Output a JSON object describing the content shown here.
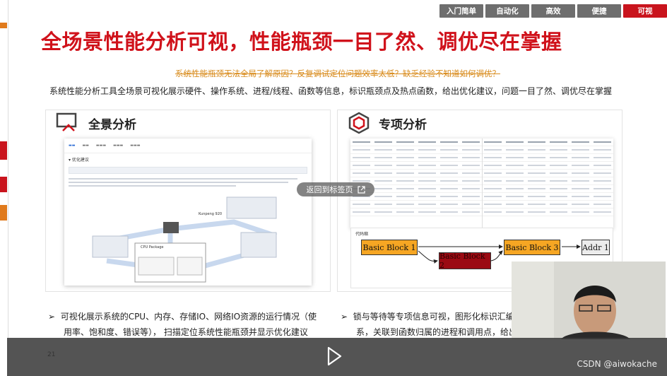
{
  "nav": {
    "tabs": [
      {
        "label": "入门简单"
      },
      {
        "label": "自动化"
      },
      {
        "label": "高效"
      },
      {
        "label": "便捷"
      },
      {
        "label": "可视"
      }
    ],
    "active_index": 4
  },
  "slide": {
    "title": "全场景性能分析可视，性能瓶颈一目了然、调优尽在掌握",
    "subtitle": "系统性能瓶颈无法全局了解原因？反复调试定位问题效率太低？缺乏经验不知道如何调优？",
    "description": "系统性能分析工具全场景可视化展示硬件、操作系统、进程/线程、函数等信息，标识瓶颈点及热点函数，给出优化建议，问题一目了然、调优尽在掌握",
    "left_panel": {
      "title": "全景分析",
      "mock_section": "优化建议",
      "cpu_label": "CPU Package",
      "kunpeng": "Kunpeng 920"
    },
    "right_panel": {
      "title": "专项分析",
      "flow_label": "代码缩",
      "blocks": [
        "Basic Block 1",
        "Basic Block 2",
        "Basic Block 3",
        "Addr 1"
      ]
    },
    "bullets": {
      "left_line1": "可视化展示系统的CPU、内存、存储IO、网络IO资源的运行情况（使",
      "left_line2": "用率、饱和度、错误等），  扫描定位系统性能瓶颈并显示优化建议",
      "right_line1": "锁与等待等专项信息可视，图形化标识汇编",
      "right_line2": "系，关联到函数归属的进程和调用点，给出"
    },
    "page_number": "21"
  },
  "tooltip": {
    "label": "返回到标签页"
  },
  "player": {
    "watermark": "CSDN @aiwokache"
  },
  "colors": {
    "accent_red": "#d0121b",
    "tab_gray": "#6e6e6e",
    "block_highlight": "#9b0a13",
    "block_fill": "#f6a623"
  }
}
